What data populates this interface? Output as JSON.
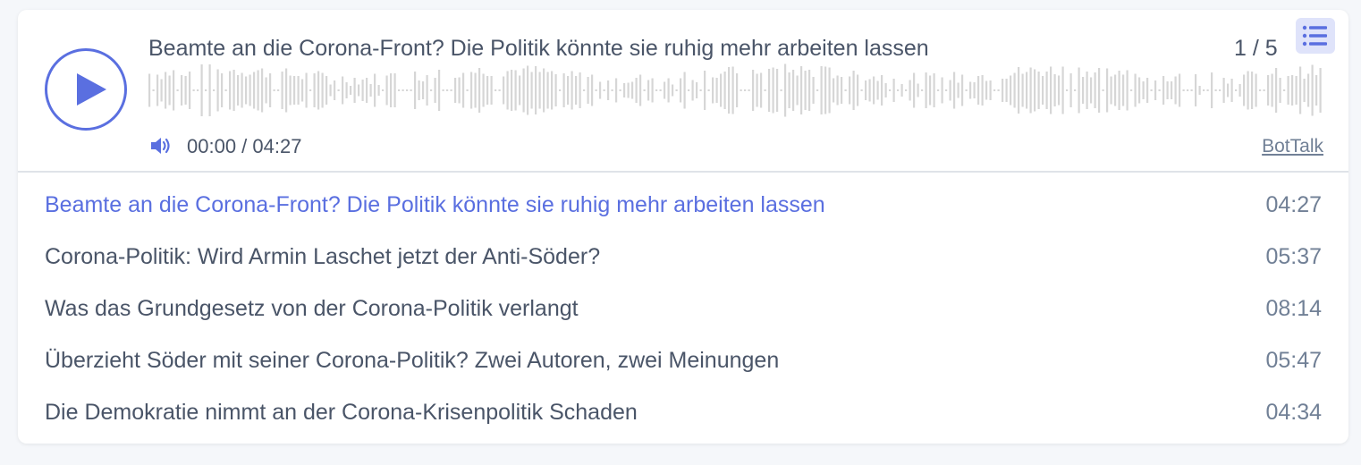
{
  "player": {
    "title": "Beamte an die Corona-Front? Die Politik könnte sie ruhig mehr arbeiten lassen",
    "counter": "1 / 5",
    "time": "00:00 / 04:27",
    "brand": "BotTalk",
    "progress": 0,
    "icons": {
      "play": "play-icon",
      "playlist": "list-icon",
      "volume": "volume-icon"
    },
    "colors": {
      "accent": "#5a6fe0",
      "waveform": "#d6d6d6",
      "list_button_bg": "#dfe3fa"
    }
  },
  "playlist": {
    "tracks": [
      {
        "title": "Beamte an die Corona-Front? Die Politik könnte sie ruhig mehr arbeiten lassen",
        "duration": "04:27",
        "active": true
      },
      {
        "title": "Corona-Politik: Wird Armin Laschet jetzt der Anti-Söder?",
        "duration": "05:37",
        "active": false
      },
      {
        "title": "Was das Grundgesetz von der Corona-Politik verlangt",
        "duration": "08:14",
        "active": false
      },
      {
        "title": "Überzieht Söder mit seiner Corona-Politik? Zwei Autoren, zwei Meinungen",
        "duration": "05:47",
        "active": false
      },
      {
        "title": "Die Demokratie nimmt an der Corona-Krisenpolitik Schaden",
        "duration": "04:34",
        "active": false
      }
    ]
  }
}
